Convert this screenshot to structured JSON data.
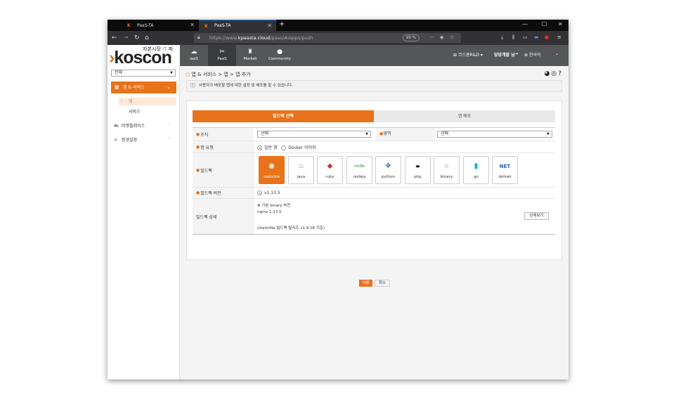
{
  "browser": {
    "tabs": [
      {
        "title": "PaaS-TA",
        "icon": "K"
      },
      {
        "title": "PaaS-TA",
        "icon": "K"
      }
    ],
    "url_prefix": "https://www.",
    "url_domain": "kpaasta.cloud",
    "url_path": "/paas/#/apps/push",
    "zoom": "90 %"
  },
  "header": {
    "tagline_a": "자본시장 ",
    "tagline_b": "IT",
    "tagline_c": " 파",
    "logo_arrow": "›",
    "logo_text": "koscon",
    "nav": [
      {
        "label": "iaaS",
        "icon": "cloud-icon"
      },
      {
        "label": "PaaS",
        "icon": "tools-icon"
      },
      {
        "label": "Market",
        "icon": "market-icon"
      },
      {
        "label": "Community",
        "icon": "community-icon"
      }
    ],
    "org": "코스콤R&D",
    "user": "담당개발 님",
    "language": "한국어"
  },
  "sidebar": {
    "select_value": "전체",
    "menu_main": "앱 & 서비스",
    "sub_active": "앱",
    "sub_item": "서비스",
    "items": [
      {
        "label": "마켓플레이스"
      },
      {
        "label": "환경설정"
      }
    ]
  },
  "main": {
    "breadcrumb": "앱 & 서비스 > 앱 > 앱 추가",
    "info": "사용자가 배포할 앱에 대한 설정 및 배포를 할 수 있습니다.",
    "steps": [
      "빌드팩 선택",
      "앱 배포"
    ],
    "labels": {
      "org": "조직",
      "space": "영역",
      "app_type": "앱 유형",
      "buildpack": "빌드팩",
      "buildpack_version": "빌드팩 버전",
      "buildpack_detail": "빌드팩 상세"
    },
    "org_select": "선택",
    "space_select": "선택",
    "app_types": [
      "일반 앱",
      "Docker 이미지"
    ],
    "buildpacks": [
      "staticfile",
      "java",
      "ruby",
      "nodejs",
      "python",
      "php",
      "binary",
      "go",
      "dotnet"
    ],
    "version": "v1.13.5",
    "detail": {
      "line1": "# 기본 binary 버전",
      "line2": "nginx  1.13.5",
      "line3": "(staticfile 빌드팩 릴리즈 v1.4.16 기준)",
      "button": "상세보기"
    },
    "next_button": "다음",
    "cancel_button": "취소"
  }
}
